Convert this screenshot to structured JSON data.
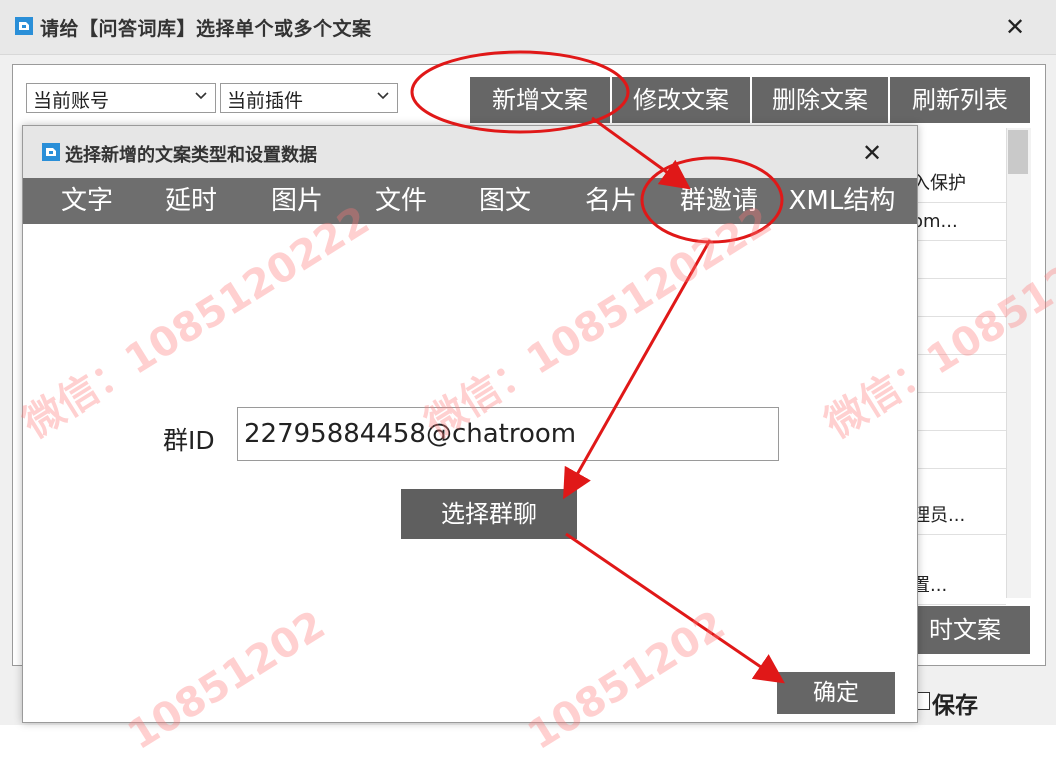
{
  "outer_window": {
    "title": "请给【问答词库】选择单个或多个文案",
    "close_glyph": "✕",
    "account_combo": "当前账号",
    "plugin_combo": "当前插件",
    "buttons": [
      "新增文案",
      "修改文案",
      "删除文案",
      "刷新列表"
    ],
    "list_fragments": [
      "入保护",
      "om...",
      "理员...",
      "置..."
    ],
    "bottom_button_fragment": "时文案",
    "save_label": "保存"
  },
  "dialog": {
    "title": "选择新增的文案类型和设置数据",
    "close_glyph": "✕",
    "type_tabs": [
      "文字",
      "延时",
      "图片",
      "文件",
      "图文",
      "名片",
      "群邀请",
      "XML结构"
    ],
    "selected_tab": "群邀请",
    "group_id_label": "群ID",
    "group_id_value": "22795884458@chatroom",
    "choose_group_button": "选择群聊",
    "confirm_button": "确定"
  },
  "watermark": {
    "text": "微信：1085120222",
    "partial": "10851202"
  },
  "colors": {
    "annotation_red": "#e01818",
    "button_gray": "#666666",
    "tabbar_gray": "#6e6e6e"
  }
}
